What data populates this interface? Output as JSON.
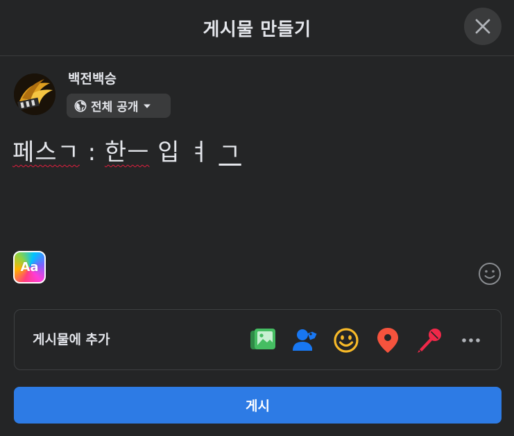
{
  "header": {
    "title": "게시물 만들기",
    "close_icon": "close-icon"
  },
  "user": {
    "name": "백전백승",
    "avatar_icon": "avatar"
  },
  "audience": {
    "label": "전체 공개",
    "icon": "globe-icon",
    "caret": "caret-down-icon"
  },
  "composer": {
    "segments": [
      "페스ㄱ",
      " : ",
      "한ㅡ",
      " 입 ㅕ ",
      "ㄱ"
    ]
  },
  "text_format": {
    "label": "Aa"
  },
  "emoji_picker": {
    "icon": "smiley-outline-icon"
  },
  "add_to_post": {
    "label": "게시물에 추가",
    "icons": [
      "photo-video-icon",
      "tag-people-icon",
      "feeling-icon",
      "check-in-icon",
      "live-mic-icon",
      "more-icon"
    ],
    "colors": {
      "photo": "#45bd62",
      "tag": "#1877f2",
      "feeling": "#f7b928",
      "checkin": "#f5533d",
      "mic": "#f02849",
      "more": "#b0b3b8"
    }
  },
  "post_button": {
    "label": "게시",
    "color": "#2d7be5"
  }
}
